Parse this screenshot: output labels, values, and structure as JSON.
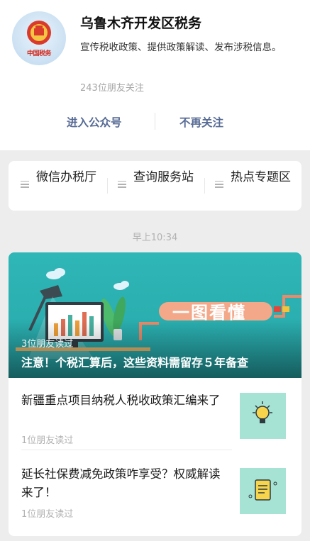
{
  "account": {
    "name": "乌鲁木齐开发区税务",
    "description": "宣传税收政策、提供政策解读、发布涉税信息。",
    "followers": "243位朋友关注",
    "avatar_text": "中国税务",
    "enter_label": "进入公众号",
    "unfollow_label": "不再关注"
  },
  "menu": {
    "items": [
      {
        "label": "微信办税厅"
      },
      {
        "label": "查询服务站"
      },
      {
        "label": "热点专题区"
      }
    ]
  },
  "timestamp": "早上10:34",
  "feature": {
    "badge": "一图看懂",
    "reads": "3位朋友读过",
    "title": "注意！个税汇算后，这些资料需留存５年备查"
  },
  "articles": [
    {
      "title": "新疆重点项目纳税人税收政策汇编来了",
      "reads": "1位朋友读过",
      "icon": "lightbulb-icon"
    },
    {
      "title": "延长社保费减免政策咋享受？权威解读来了！",
      "reads": "1位朋友读过",
      "icon": "document-icon"
    }
  ],
  "colors": {
    "link": "#576b95",
    "cover": "#2fb6b6",
    "thumb": "#a6e3d4"
  }
}
